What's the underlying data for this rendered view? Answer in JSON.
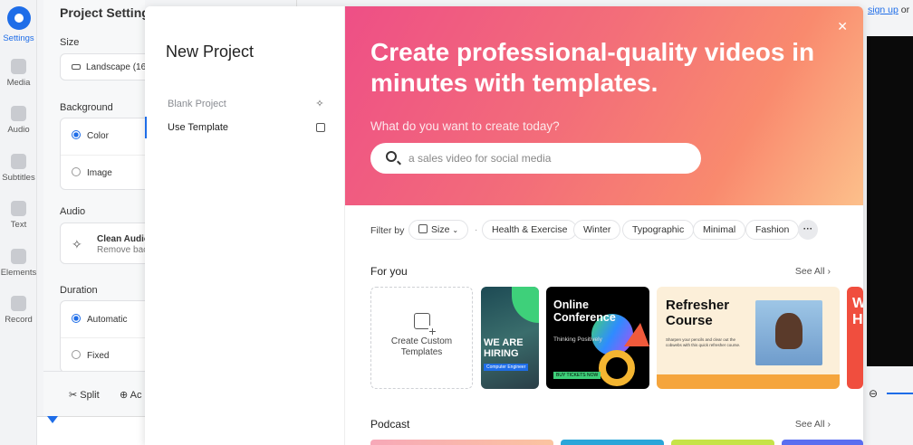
{
  "app": {
    "rail": [
      {
        "label": "Settings",
        "icon": "settings-icon",
        "active": true
      },
      {
        "label": "Media",
        "icon": "plus-icon"
      },
      {
        "label": "Audio",
        "icon": "music-note-icon"
      },
      {
        "label": "Subtitles",
        "icon": "subtitles-icon"
      },
      {
        "label": "Text",
        "icon": "text-icon"
      },
      {
        "label": "Elements",
        "icon": "elements-icon"
      },
      {
        "label": "Record",
        "icon": "record-icon"
      }
    ],
    "panel": {
      "title": "Project Settings",
      "size_label": "Size",
      "size_value": "Landscape (16",
      "background_label": "Background",
      "bg_color": "Color",
      "bg_image": "Image",
      "audio_label": "Audio",
      "audio_title": "Clean Audio",
      "audio_sub": "Remove back",
      "duration_label": "Duration",
      "dur_auto": "Automatic",
      "dur_fixed": "Fixed"
    },
    "toolbar": {
      "split": "Split",
      "add": "Ac"
    },
    "signup": {
      "link": "sign up",
      "rest": " or"
    }
  },
  "modal": {
    "title": "New Project",
    "menu": [
      {
        "label": "Blank Project",
        "icon": "sparkle-icon"
      },
      {
        "label": "Use Template",
        "icon": "template-icon"
      }
    ],
    "hero": {
      "headline": "Create professional-quality videos in minutes with templates.",
      "question": "What do you want to create today?",
      "search_placeholder": "a sales video for social media"
    },
    "filter": {
      "label": "Filter by",
      "size": "Size",
      "chips": [
        "Health & Exercise",
        "Winter",
        "Typographic",
        "Minimal",
        "Fashion"
      ],
      "more": "···"
    },
    "for_you": {
      "title": "For you",
      "see_all": "See All",
      "custom": "Create Custom Templates",
      "hiring": {
        "text": "WE ARE HIRING",
        "badge": "Computer Engineer"
      },
      "conference": {
        "title": "Online Conference",
        "theme": "Thinking Positively",
        "badge": "BUY TICKETS NOW"
      },
      "refresher": {
        "title": "Refresher Course",
        "desc": "Sharpen your pencils and clear out the cobwebs with this quick refresher course."
      },
      "partial": "W H"
    },
    "podcast": {
      "title": "Podcast",
      "see_all": "See All"
    }
  }
}
